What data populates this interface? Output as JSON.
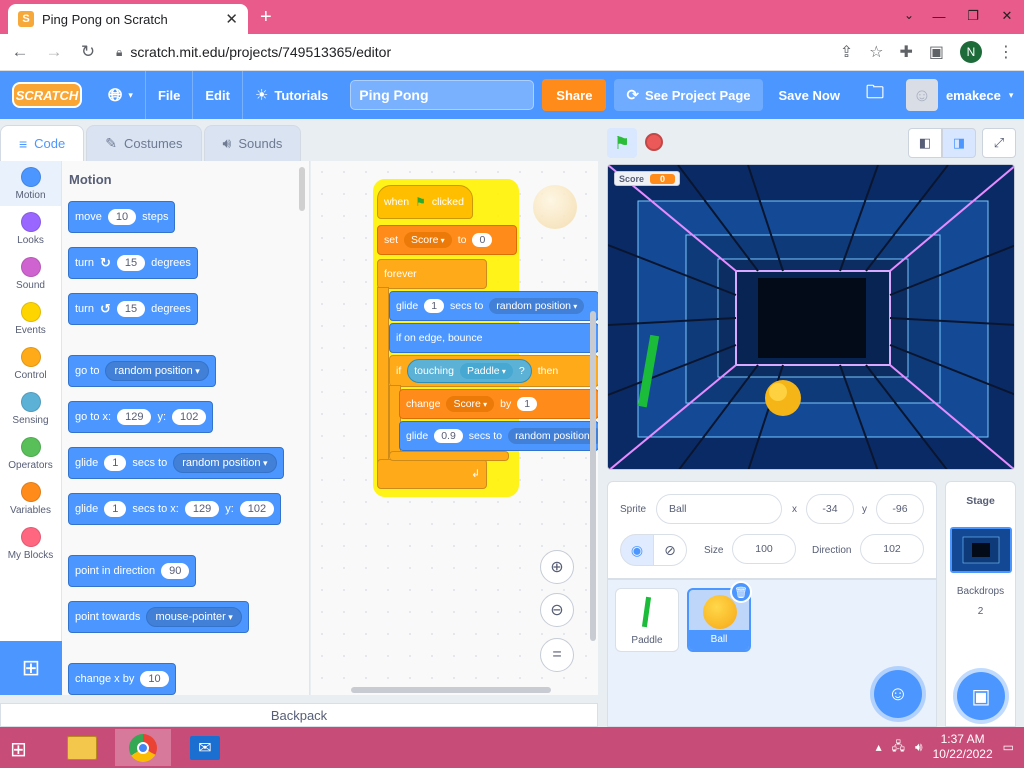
{
  "browser": {
    "tab_title": "Ping Pong on Scratch",
    "tab_favicon": "S",
    "url": "scratch.mit.edu/projects/749513365/editor",
    "profile_initial": "N"
  },
  "menubar": {
    "logo_text": "SCRATCH",
    "file": "File",
    "edit": "Edit",
    "tutorials": "Tutorials",
    "project_title": "Ping Pong",
    "share": "Share",
    "see_project_page": "See Project Page",
    "save_now": "Save Now",
    "username": "emakece"
  },
  "editor_tabs": {
    "code": "Code",
    "costumes": "Costumes",
    "sounds": "Sounds"
  },
  "categories": [
    {
      "label": "Motion",
      "color": "#4c97ff"
    },
    {
      "label": "Looks",
      "color": "#9966ff"
    },
    {
      "label": "Sound",
      "color": "#cf63cf"
    },
    {
      "label": "Events",
      "color": "#ffd500"
    },
    {
      "label": "Control",
      "color": "#ffab19"
    },
    {
      "label": "Sensing",
      "color": "#5cb1d6"
    },
    {
      "label": "Operators",
      "color": "#59c059"
    },
    {
      "label": "Variables",
      "color": "#ff8c1a"
    },
    {
      "label": "My Blocks",
      "color": "#ff6680"
    }
  ],
  "palette": {
    "heading": "Motion",
    "move": {
      "pre": "move",
      "val": "10",
      "post": "steps"
    },
    "turn_right": {
      "pre": "turn",
      "val": "15",
      "post": "degrees"
    },
    "turn_left": {
      "pre": "turn",
      "val": "15",
      "post": "degrees"
    },
    "go_to": {
      "pre": "go to",
      "drop": "random position"
    },
    "go_to_xy": {
      "pre": "go to x:",
      "x": "129",
      "ylbl": "y:",
      "y": "102"
    },
    "glide_to": {
      "pre": "glide",
      "val": "1",
      "mid": "secs to",
      "drop": "random position"
    },
    "glide_xy": {
      "pre": "glide",
      "val": "1",
      "mid": "secs to x:",
      "x": "129",
      "ylbl": "y:",
      "y": "102"
    },
    "point_dir": {
      "pre": "point in direction",
      "val": "90"
    },
    "point_towards": {
      "pre": "point towards",
      "drop": "mouse-pointer"
    },
    "change_x": {
      "pre": "change x by",
      "val": "10"
    }
  },
  "script": {
    "hat": {
      "pre": "when",
      "post": "clicked"
    },
    "set": {
      "pre": "set",
      "var": "Score",
      "mid": "to",
      "val": "0"
    },
    "forever": "forever",
    "glide": {
      "pre": "glide",
      "val": "1",
      "mid": "secs to",
      "drop": "random position"
    },
    "bounce": "if on edge, bounce",
    "if": {
      "pre": "if",
      "touching": "touching",
      "obj": "Paddle",
      "q": "?",
      "then": "then"
    },
    "change": {
      "pre": "change",
      "var": "Score",
      "mid": "by",
      "val": "1"
    },
    "glide2": {
      "pre": "glide",
      "val": "0.9",
      "mid": "secs to",
      "drop": "random position"
    }
  },
  "backpack": "Backpack",
  "stage": {
    "monitor_label": "Score",
    "monitor_value": "0"
  },
  "sprite_info": {
    "sprite_label": "Sprite",
    "sprite_name": "Ball",
    "x_label": "x",
    "x": "-34",
    "y_label": "y",
    "y": "-96",
    "show_label": "",
    "size_label": "Size",
    "size": "100",
    "direction_label": "Direction",
    "direction": "102"
  },
  "sprites": [
    {
      "name": "Paddle"
    },
    {
      "name": "Ball"
    }
  ],
  "stage_pane": {
    "title": "Stage",
    "backdrops_label": "Backdrops",
    "backdrops_count": "2"
  },
  "taskbar": {
    "time": "1:37 AM",
    "date": "10/22/2022"
  }
}
